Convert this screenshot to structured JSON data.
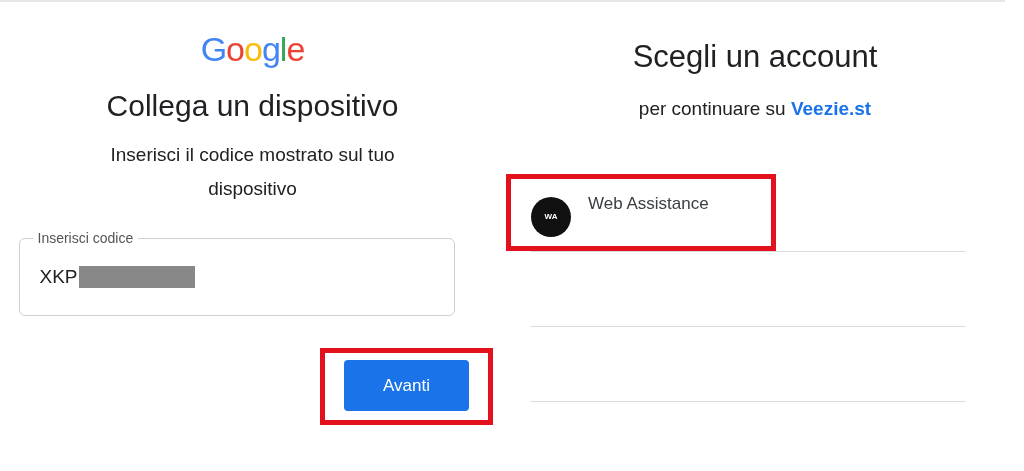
{
  "link_device": {
    "logo": {
      "text": "Google"
    },
    "title": "Collega un dispositivo",
    "subtitle": "Inserisci il codice mostrato sul tuo dispositivo",
    "code_field": {
      "label": "Inserisci codice",
      "value": "XKP",
      "redacted": true
    },
    "next_button": {
      "label": "Avanti",
      "highlighted": true
    }
  },
  "choose_account": {
    "title": "Scegli un account",
    "subtitle_prefix": "per continuare su",
    "app_name": "Veezie.st",
    "accounts": [
      {
        "name": "Web Assistance",
        "avatar_text": "WA",
        "highlighted": true
      }
    ]
  }
}
